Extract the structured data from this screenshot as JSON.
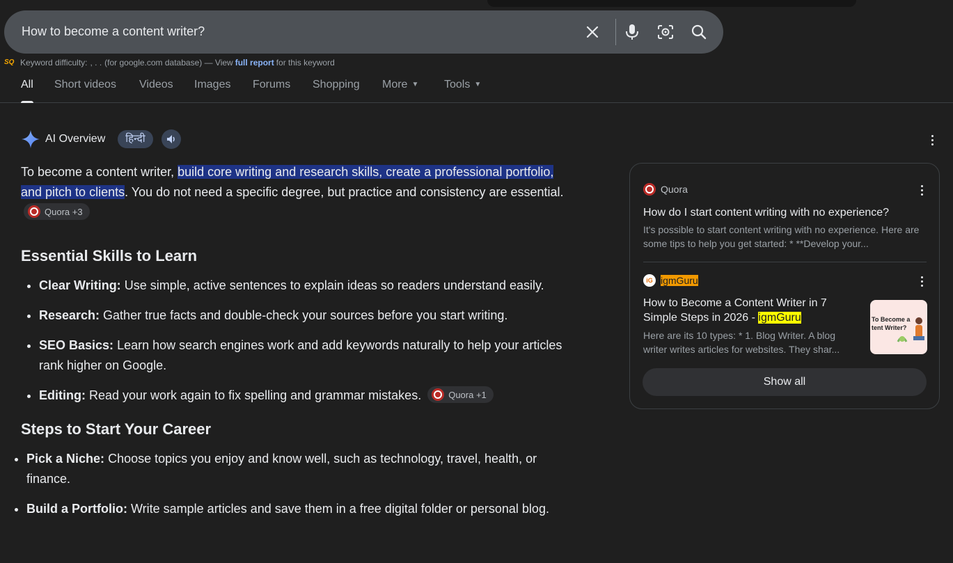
{
  "search": {
    "query": "How to become a content writer?"
  },
  "keyword_bar": {
    "prefix": "Keyword difficulty:",
    "value": ", . .",
    "database": "(for google.com database) — View",
    "link": "full report",
    "suffix": "for this keyword",
    "logo_text": "SQ"
  },
  "tabs": [
    {
      "label": "All"
    },
    {
      "label": "Short videos"
    },
    {
      "label": "Videos"
    },
    {
      "label": "Images"
    },
    {
      "label": "Forums"
    },
    {
      "label": "Shopping"
    },
    {
      "label": "More"
    },
    {
      "label": "Tools"
    }
  ],
  "ai_overview": {
    "title": "AI Overview",
    "language_chip": "हिन्दी",
    "intro_before": "To become a content writer, ",
    "intro_highlight": "build core writing and research skills, create a professional portfolio, and pitch to clients",
    "intro_after": ". You do not need a specific degree, but practice and consistency are essential.",
    "intro_source": "Quora +3",
    "skills_heading": "Essential Skills to Learn",
    "skills": [
      {
        "title": "Clear Writing:",
        "text": " Use simple, active sentences to explain ideas so readers understand easily."
      },
      {
        "title": "Research:",
        "text": " Gather true facts and double-check your sources before you start writing."
      },
      {
        "title": "SEO Basics:",
        "text": " Learn how search engines work and add keywords naturally to help your articles rank higher on Google."
      },
      {
        "title": "Editing:",
        "text": " Read your work again to fix spelling and grammar mistakes.",
        "source": "Quora +1"
      }
    ],
    "steps_heading": "Steps to Start Your Career",
    "steps": [
      {
        "title": "Pick a Niche:",
        "text": " Choose topics you enjoy and know well, such as technology, travel, health, or finance."
      },
      {
        "title": "Build a Portfolio:",
        "text": " Write sample articles and save them in a free digital folder or personal blog."
      }
    ]
  },
  "sources_card": {
    "items": [
      {
        "source": "Quora",
        "title": "How do I start content writing with no experience?",
        "snippet": "It's possible to start content writing with no experience. Here are some tips to help you get started: * **Develop your..."
      },
      {
        "source": "igmGuru",
        "title": "How to Become a Content Writer in 7 Simple Steps in 2026 - ",
        "title_mark": "igmGuru",
        "snippet": "Here are its 10 types: * 1. Blog Writer. A blog writer writes articles for websites. They shar...",
        "thumb_text": "To Become a tent Writer?"
      }
    ],
    "show_all": "Show all"
  },
  "colors": {
    "background": "#1f1f1f",
    "search_bar": "#4d5156",
    "highlight": "#1e3386",
    "link": "#8ab4f8",
    "quora": "#b92b27",
    "chip": "#394457"
  }
}
